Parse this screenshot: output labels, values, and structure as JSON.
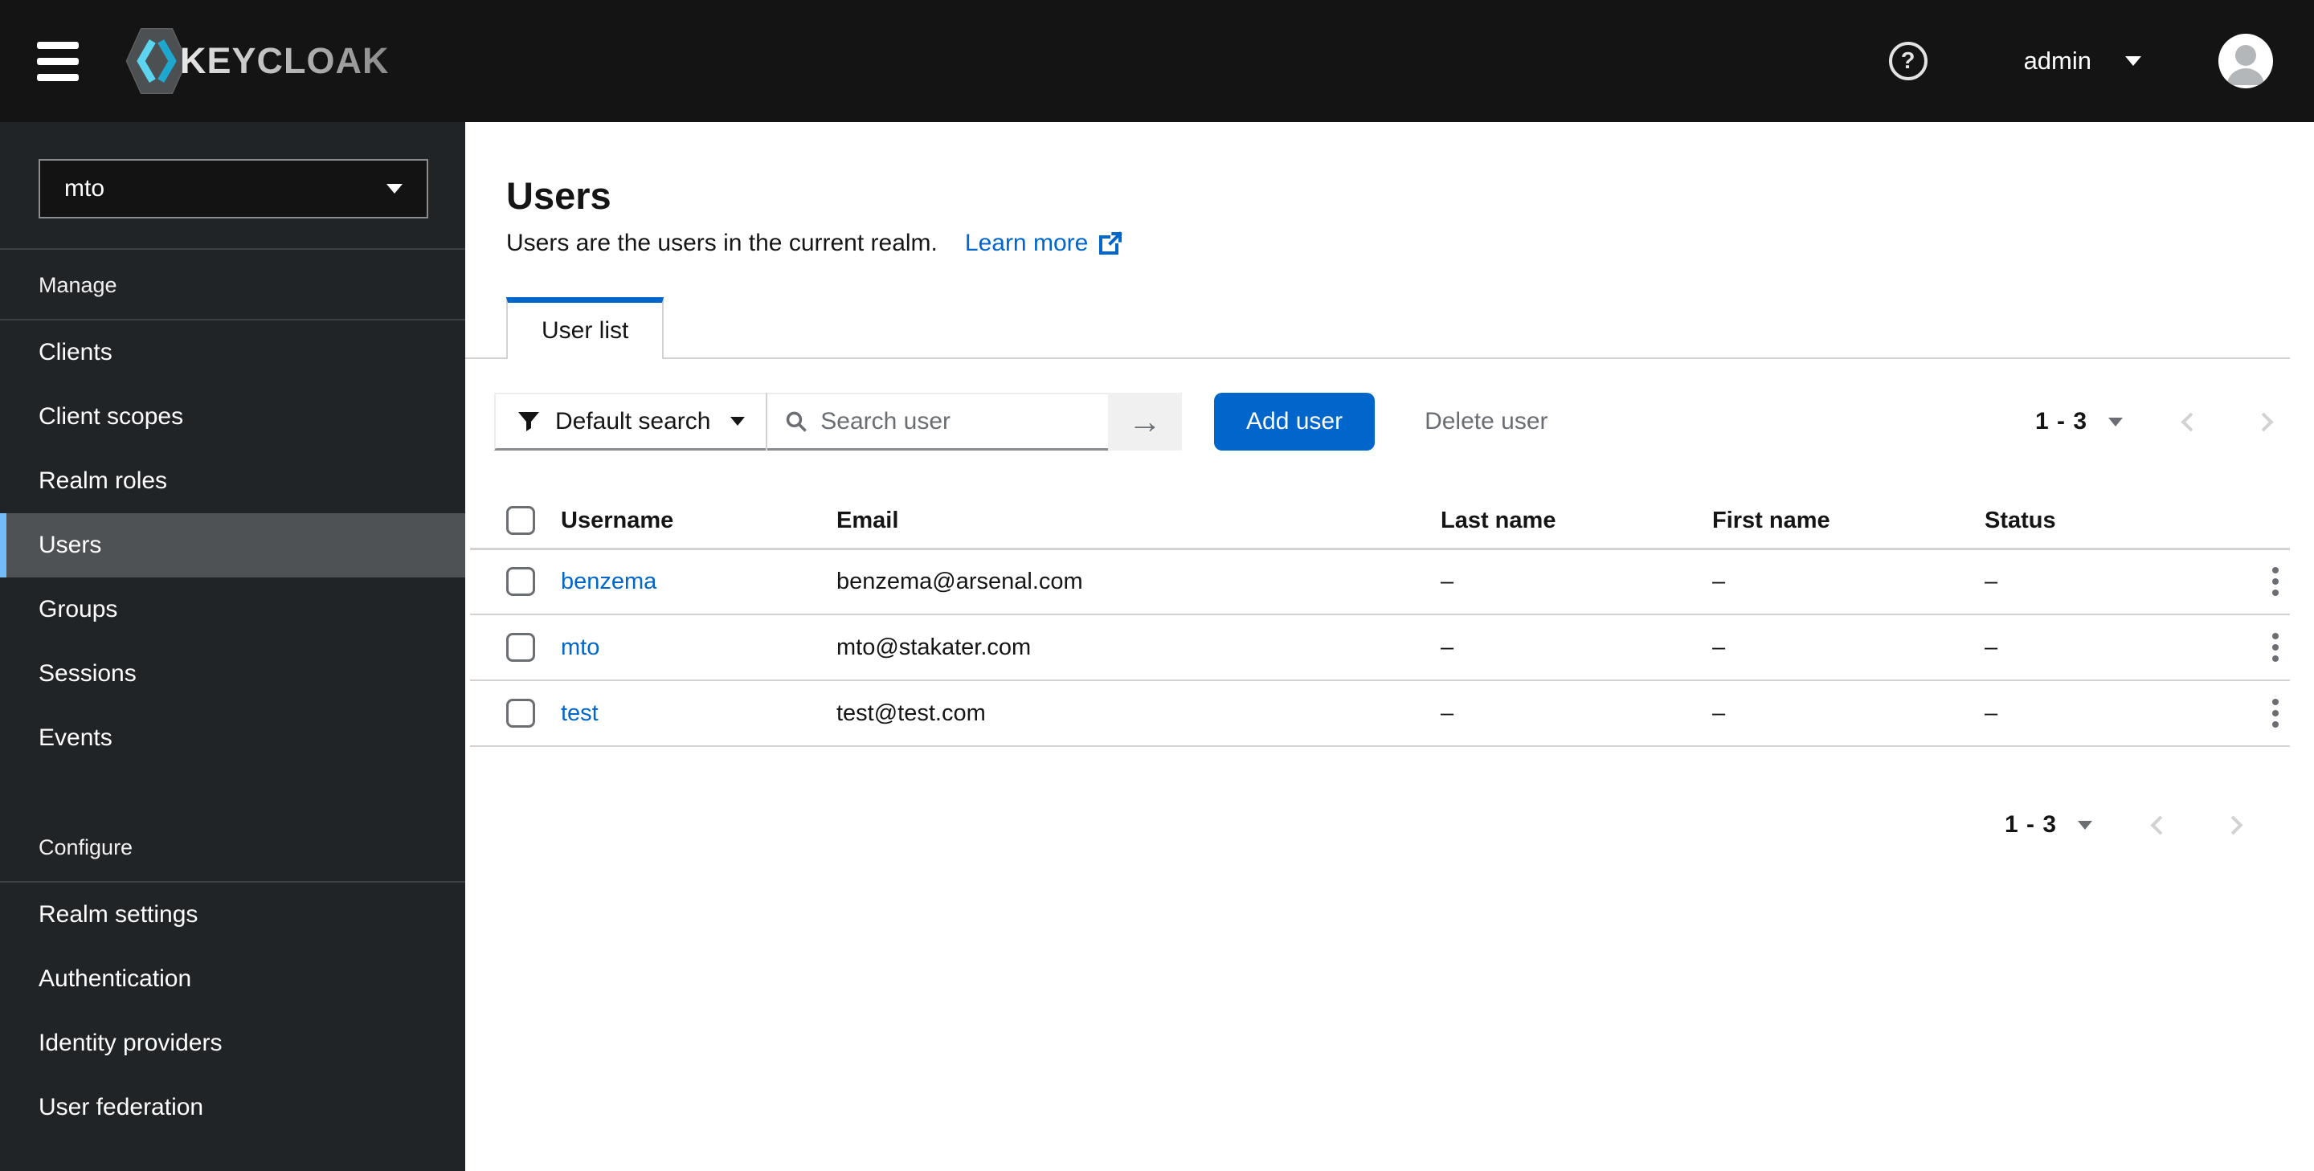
{
  "masthead": {
    "brand": "KEYCLOAK",
    "user": "admin"
  },
  "sidebar": {
    "realm": "mto",
    "sections": [
      {
        "label": "Manage",
        "items": [
          {
            "label": "Clients"
          },
          {
            "label": "Client scopes"
          },
          {
            "label": "Realm roles"
          },
          {
            "label": "Users",
            "selected": true
          },
          {
            "label": "Groups"
          },
          {
            "label": "Sessions"
          },
          {
            "label": "Events"
          }
        ]
      },
      {
        "label": "Configure",
        "items": [
          {
            "label": "Realm settings"
          },
          {
            "label": "Authentication"
          },
          {
            "label": "Identity providers"
          },
          {
            "label": "User federation"
          }
        ]
      }
    ]
  },
  "page": {
    "title": "Users",
    "description": "Users are the users in the current realm.",
    "learn_more_label": "Learn more",
    "tab_label": "User list"
  },
  "toolbar": {
    "filter_label": "Default search",
    "search_placeholder": "Search user",
    "arrow_label": "→",
    "add_user_label": "Add user",
    "delete_user_label": "Delete user",
    "pagination_range": "1 - 3"
  },
  "table": {
    "columns": [
      "Username",
      "Email",
      "Last name",
      "First name",
      "Status"
    ],
    "rows": [
      {
        "username": "benzema",
        "email": "benzema@arsenal.com",
        "last_name": "–",
        "first_name": "–",
        "status": "–"
      },
      {
        "username": "mto",
        "email": "mto@stakater.com",
        "last_name": "–",
        "first_name": "–",
        "status": "–"
      },
      {
        "username": "test",
        "email": "test@test.com",
        "last_name": "–",
        "first_name": "–",
        "status": "–"
      }
    ]
  },
  "footer": {
    "pagination_range": "1 - 3"
  },
  "colors": {
    "primary_blue": "#0066cc",
    "link_blue": "#0066cc",
    "masthead_bg": "#141414",
    "sidebar_bg": "#212427",
    "selected_nav_bg": "#4f5255",
    "selected_nav_border": "#73bcf7",
    "logo_cyan": "#3bc0dd",
    "border_gray": "#d2d2d2",
    "muted_text": "#6a6e73"
  }
}
